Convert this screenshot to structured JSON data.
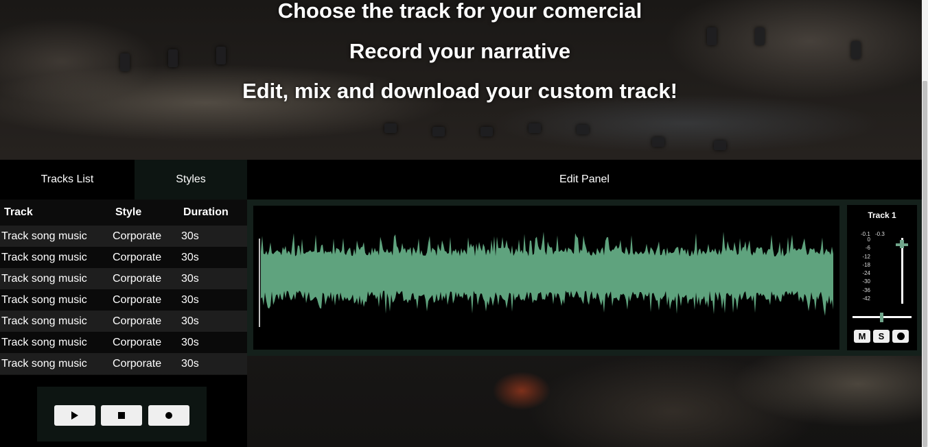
{
  "hero": {
    "line1": "Choose the track for your comercial",
    "line2": "Record your narrative",
    "line3": "Edit, mix and download your custom track!"
  },
  "tabs": {
    "tracks_list": "Tracks List",
    "styles": "Styles",
    "edit_panel": "Edit Panel"
  },
  "table": {
    "headers": [
      "Track",
      "Style",
      "Duration"
    ],
    "rows": [
      [
        "Track song music",
        "Corporate",
        "30s"
      ],
      [
        "Track song music",
        "Corporate",
        "30s"
      ],
      [
        "Track song music",
        "Corporate",
        "30s"
      ],
      [
        "Track song music",
        "Corporate",
        "30s"
      ],
      [
        "Track song music",
        "Corporate",
        "30s"
      ],
      [
        "Track song music",
        "Corporate",
        "30s"
      ],
      [
        "Track song music",
        "Corporate",
        "30s"
      ]
    ]
  },
  "transport": {
    "play_icon": "play-icon",
    "stop_icon": "stop-icon",
    "record_icon": "record-icon"
  },
  "mixer": {
    "title": "Track 1",
    "peak_left": "-0.1",
    "peak_right": "-0.3",
    "db_scale": [
      "0",
      "-6",
      "-12",
      "-18",
      "-24",
      "-30",
      "-36",
      "-42"
    ],
    "mute_label": "M",
    "solo_label": "S",
    "record_icon": "record-icon"
  },
  "colors": {
    "waveform": "#5fa37e",
    "slider_accent": "#6fa58a",
    "panel_bg": "#14201b"
  }
}
